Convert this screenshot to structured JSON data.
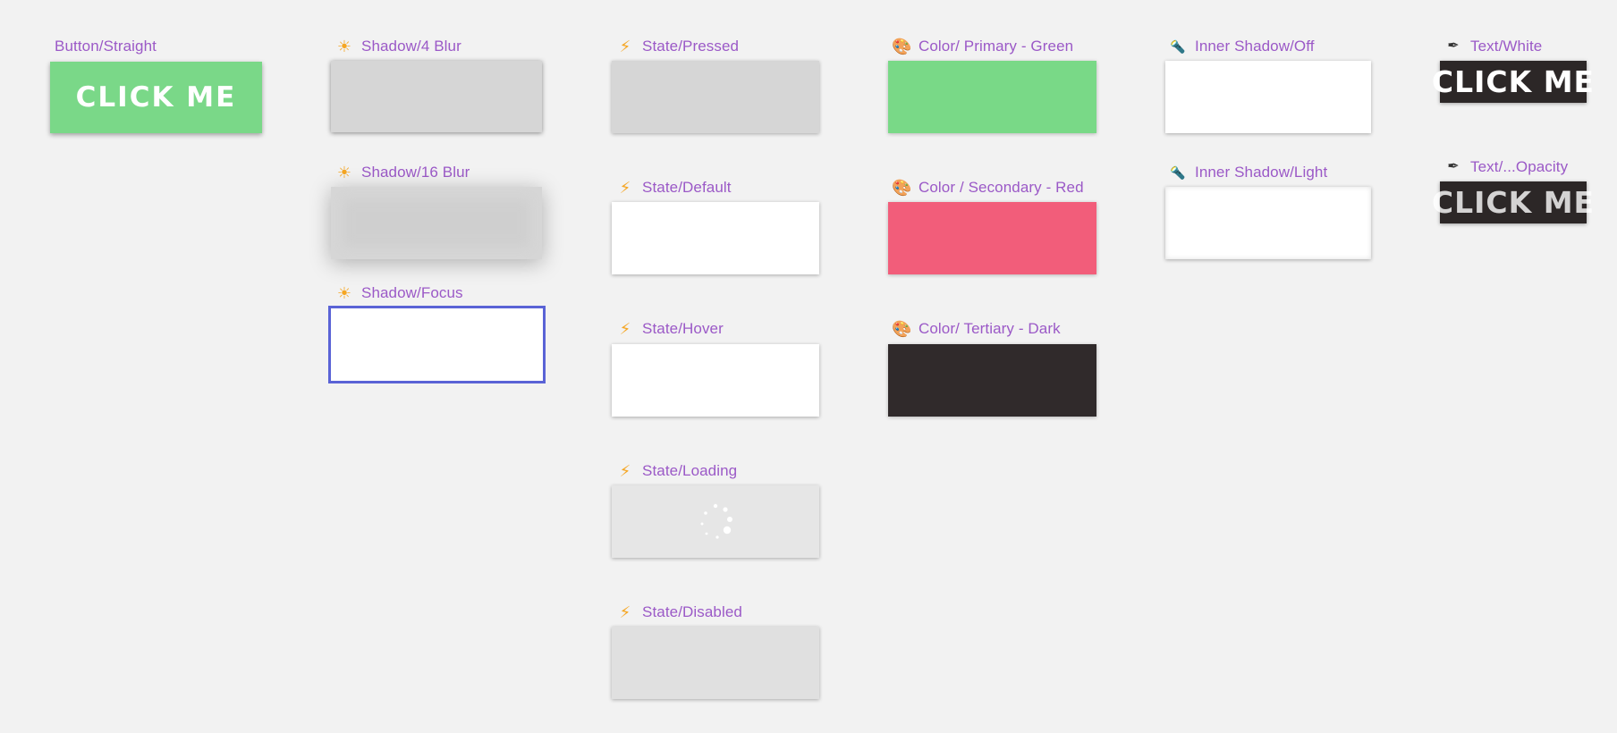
{
  "components": {
    "button_straight": {
      "label": "Button/Straight",
      "button_text": "CLICK ME"
    },
    "shadow_4_blur": {
      "label": "Shadow/4 Blur",
      "icon": "sun-icon"
    },
    "shadow_16_blur": {
      "label": "Shadow/16 Blur",
      "icon": "sun-icon"
    },
    "shadow_focus": {
      "label": "Shadow/Focus",
      "icon": "sun-icon"
    },
    "state_pressed": {
      "label": "State/Pressed",
      "icon": "lightning-icon"
    },
    "state_default": {
      "label": "State/Default",
      "icon": "lightning-icon"
    },
    "state_hover": {
      "label": "State/Hover",
      "icon": "lightning-icon"
    },
    "state_loading": {
      "label": "State/Loading",
      "icon": "lightning-icon"
    },
    "state_disabled": {
      "label": "State/Disabled",
      "icon": "lightning-icon"
    },
    "color_primary": {
      "label": "Color/ Primary - Green",
      "icon": "palette-icon",
      "color": "#79d987"
    },
    "color_secondary": {
      "label": "Color / Secondary - Red",
      "icon": "palette-icon",
      "color": "#f25d7a"
    },
    "color_tertiary": {
      "label": "Color/ Tertiary - Dark",
      "icon": "palette-icon",
      "color": "#302a2b"
    },
    "inner_shadow_off": {
      "label": "Inner Shadow/Off",
      "icon": "flashlight-icon"
    },
    "inner_shadow_light": {
      "label": "Inner Shadow/Light",
      "icon": "flashlight-icon"
    },
    "text_white": {
      "label": "Text/White",
      "icon": "pen-icon",
      "sample": "CLICK ME"
    },
    "text_opacity": {
      "label": "Text/...Opacity",
      "icon": "pen-icon",
      "sample": "CLICK ME"
    }
  },
  "colors": {
    "label": "#9b59c7",
    "canvas": "#f2f2f2",
    "focus_border": "#5a63d6"
  }
}
